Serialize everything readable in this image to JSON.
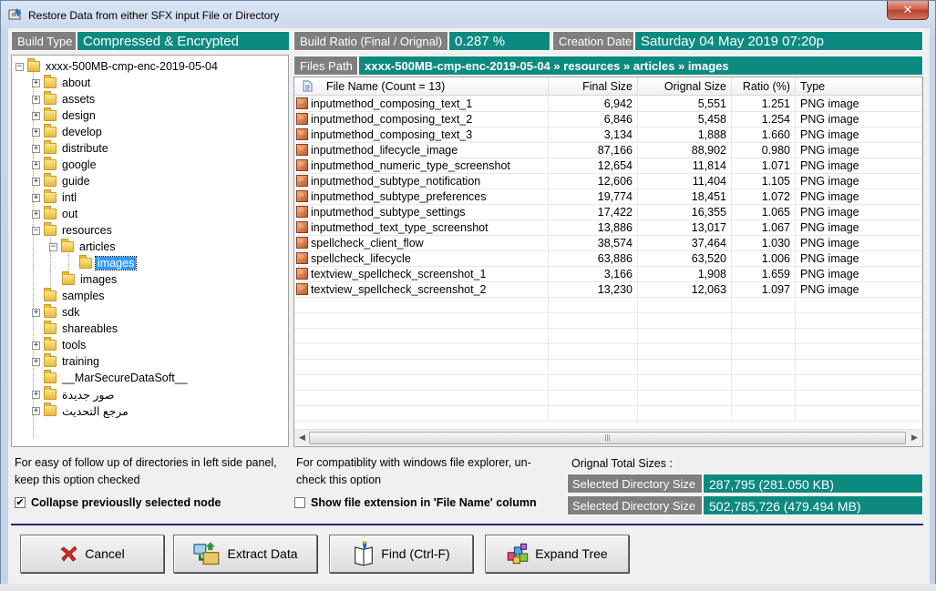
{
  "window": {
    "title": "Restore Data from either SFX input File or Directory",
    "close_label": "✕"
  },
  "header": {
    "build_type_label": "Build Type",
    "build_type_value": "Compressed & Encrypted",
    "build_ratio_label": "Build Ratio (Final / Orignal)",
    "build_ratio_value": "0.287 %",
    "creation_date_label": "Creation Date",
    "creation_date_value": "Saturday  04 May 2019 07:20p",
    "files_path_label": "Files Path",
    "files_path_value": "xxxx-500MB-cmp-enc-2019-05-04 » resources » articles » images"
  },
  "tree": {
    "root": "xxxx-500MB-cmp-enc-2019-05-04",
    "items": [
      "about",
      "assets",
      "design",
      "develop",
      "distribute",
      "google",
      "guide",
      "intl",
      "out",
      "resources",
      "articles",
      "images",
      "images",
      "samples",
      "sdk",
      "shareables",
      "tools",
      "training",
      "__MarSecureDataSoft__",
      "صور جديدة",
      "مرجع التحديث"
    ]
  },
  "file_list": {
    "columns": [
      "File Name (Count = 13)",
      "Final Size",
      "Orignal Size",
      "Ratio (%)",
      "Type"
    ],
    "rows": [
      [
        "inputmethod_composing_text_1",
        "6,942",
        "5,551",
        "1.251",
        "PNG image"
      ],
      [
        "inputmethod_composing_text_2",
        "6,846",
        "5,458",
        "1.254",
        "PNG image"
      ],
      [
        "inputmethod_composing_text_3",
        "3,134",
        "1,888",
        "1.660",
        "PNG image"
      ],
      [
        "inputmethod_lifecycle_image",
        "87,166",
        "88,902",
        "0.980",
        "PNG image"
      ],
      [
        "inputmethod_numeric_type_screenshot",
        "12,654",
        "11,814",
        "1.071",
        "PNG image"
      ],
      [
        "inputmethod_subtype_notification",
        "12,606",
        "11,404",
        "1.105",
        "PNG image"
      ],
      [
        "inputmethod_subtype_preferences",
        "19,774",
        "18,451",
        "1.072",
        "PNG image"
      ],
      [
        "inputmethod_subtype_settings",
        "17,422",
        "16,355",
        "1.065",
        "PNG image"
      ],
      [
        "inputmethod_text_type_screenshot",
        "13,886",
        "13,017",
        "1.067",
        "PNG image"
      ],
      [
        "spellcheck_client_flow",
        "38,574",
        "37,464",
        "1.030",
        "PNG image"
      ],
      [
        "spellcheck_lifecycle",
        "63,886",
        "63,520",
        "1.006",
        "PNG image"
      ],
      [
        "textview_spellcheck_screenshot_1",
        "3,166",
        "1,908",
        "1.659",
        "PNG image"
      ],
      [
        "textview_spellcheck_screenshot_2",
        "13,230",
        "12,063",
        "1.097",
        "PNG image"
      ]
    ]
  },
  "options": {
    "collapse_help": "For easy of follow up of directories in left side panel, keep this option checked",
    "collapse_label": "Collapse previouslly selected node",
    "collapse_checked": true,
    "extension_help": "For compatiblity with windows file explorer, un-check this option",
    "extension_label": "Show file extension in 'File Name' column",
    "extension_checked": false
  },
  "totals": {
    "heading": "Orignal Total Sizes :",
    "selected_dir_label": "Selected Directory Size",
    "selected_dir_value": "287,795 (281.050 KB)",
    "second_label": "Selected Directory Size",
    "second_value": "502,785,726 (479.494 MB)"
  },
  "buttons": {
    "cancel": "Cancel",
    "extract": "Extract Data",
    "find": "Find (Ctrl-F)",
    "expand": "Expand Tree"
  },
  "colors": {
    "accent": "#0d8a80",
    "label_gray": "#7f7f7f",
    "selection": "#3399ff"
  }
}
